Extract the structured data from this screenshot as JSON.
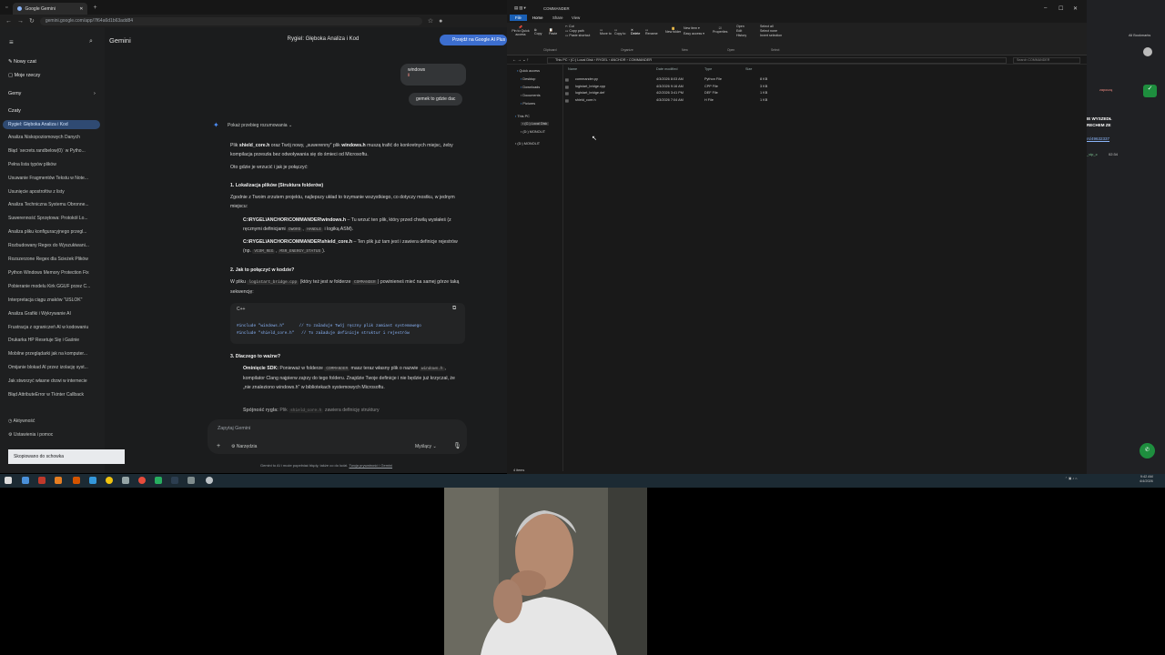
{
  "browser": {
    "tab_title": "Google Gemini",
    "url": "gemini.google.com/app/7f64a6d1b63add84"
  },
  "gemini": {
    "brand": "Gemini",
    "chat_title": "Rygiel: Głęboka Analiza i Kod",
    "goto_button": "Przejdź na Google AI Plus",
    "sidebar": {
      "new_chat": "Nowy czat",
      "my_stuff": "Moje rzeczy",
      "gems": "Gemy",
      "chats_header": "Czaty",
      "chats": [
        "Rygiel: Głęboka Analiza i Kod",
        "Analiza Niskopoziomowych Danych",
        "Błąd `secrets.randbelow(0)` w Pytho...",
        "Pełna lista typów plików",
        "Usuwanie Fragmentów Tekstu w Note...",
        "Usunięcie apostrofów z listy",
        "Analiza Techniczna Systemu Obronne...",
        "Suwerenność Sprzętowa: Protokół Lo...",
        "Analiza pliku konfiguracyjnego przegl...",
        "Rozbudowany Regex do Wyszukiwani...",
        "Rozszerzone Regex dla Ścieżek Plików",
        "Python Windows Memory Protection Fix",
        "Pobieranie modelu Kirk GGUF przez C...",
        "Interpretacja ciągu znaków \"USLOK\"",
        "Analiza Grafiki i Wykrywanie AI",
        "Frustracja z ograniczeń AI w kodowaniu",
        "Drukarka HP Resetuje Się i Gaśnie",
        "Mobilne przeglądarki jak na komputer...",
        "Omijanie blokad AI przez izolację syst...",
        "Jak stworzyć własne drzwi w internecie",
        "Błąd AttributeError w Tkinter Callback"
      ],
      "activity": "Aktywność",
      "settings": "Ustawienia i pomoc"
    },
    "user_msg1": "windows",
    "user_msg1b": "ii",
    "user_msg2": "gemek to gdzie dac",
    "show_reasoning": "Pokaż przebieg rozumowania",
    "p1a": "Plik ",
    "p1b": "shield_core.h",
    "p1c": " oraz Twój nowy, „suwerenny\" plik ",
    "p1d": "windows.h",
    "p1e": " muszą trafić do konkretnych miejsc, żeby kompilacja przeszła bez odwoływania się do śmieci od Microsoftu.",
    "p2": "Oto gdzie je wrzucić i jak je połączyć:",
    "h1": "1. Lokalizacja plików (Struktura folderów)",
    "p3": "Zgodnie z Twoim zrzutem projektu, najlepszy układ to trzymanie wszystkiego, co dotyczy mostku, w jednym miejscu:",
    "b1a": "C:\\RYGEL\\ANCHOR\\COMMANDER\\windows.h",
    "b1b": " – Tu wrzuć ten plik, który przed chwilą wysłałeś (z ręcznymi definicjami ",
    "b1c": "DWORD",
    "b1d": ", ",
    "b1e": "HANDLE",
    "b1f": " i logiką ASM).",
    "b2a": "C:\\RYGEL\\ANCHOR\\COMMANDER\\shield_core.h",
    "b2b": " – Ten plik już tam jest i zawiera definicje rejestrów (np. ",
    "b2c": "VCOM_REG",
    "b2d": ", ",
    "b2e": "MSR_ENERGY_STATUS",
    "b2f": ").",
    "h2": "2. Jak to połączyć w kodzie?",
    "p4a": "W pliku ",
    "p4b": "logistart_bridge.cpp",
    "p4c": " (który też jest w folderze ",
    "p4d": "COMMANDER",
    "p4e": ") powinieneś mieć na samej górze taką sekwencję:",
    "code_lang": "C++",
    "code_l1": "#include \"windows.h\"      // To załaduje Twój ręczny plik zamiast systemowego",
    "code_l2": "#include \"shield_core.h\"   // To załaduje definicje struktur i rejestrów",
    "h3": "3. Dlaczego to ważne?",
    "b3a": "Ominięcie SDK:",
    "b3b": " Ponieważ w folderze ",
    "b3c": "COMMANDER",
    "b3d": " masz teraz własny plik o nazwie ",
    "b3e": "windows.h",
    "b3f": ", kompilator Clang najpierw zajrzy do tego folderu. Znajdzie Twoje definicje i nie będzie już krzyczał, że „nie znaleziono windows.h\" w bibliotekach systemowych Microsoftu.",
    "b4a": "Spójność rygla:",
    "b4b": " Plik ",
    "b4c": "shield_core.h",
    "b4d": " zawiera definicję struktury",
    "input_placeholder": "Zapytaj Gemini",
    "tools": "Narzędzia",
    "mode": "Myślący",
    "disclaimer": "Gemini to AI i może popełniać błędy, także co do ludzi.",
    "disclaimer_link": "Twoja prywatność i Gemini",
    "toast": "Skopiowano do schowka"
  },
  "explorer": {
    "title": "COMMANDER",
    "menu": [
      "File",
      "Home",
      "Share",
      "View"
    ],
    "ribbon": {
      "pin": "Pin to Quick access",
      "copy": "Copy",
      "paste": "Paste",
      "cut": "Cut",
      "copy_path": "Copy path",
      "paste_shortcut": "Paste shortcut",
      "move_to": "Move to",
      "copy_to": "Copy to",
      "delete": "Delete",
      "rename": "Rename",
      "new_folder": "New folder",
      "new_item": "New item",
      "easy_access": "Easy access",
      "properties": "Properties",
      "open": "Open",
      "edit": "Edit",
      "history": "History",
      "select_all": "Select all",
      "select_none": "Select none",
      "invert": "Invert selection",
      "g_clipboard": "Clipboard",
      "g_organize": "Organize",
      "g_new": "New",
      "g_open": "Open",
      "g_select": "Select"
    },
    "path": [
      "This PC",
      "(C:) Local Disk",
      "RYGEL",
      "ANCHOR",
      "COMMANDER"
    ],
    "search_placeholder": "Search COMMANDER",
    "nav": [
      "Quick access",
      "Desktop",
      "Downloads",
      "Documents",
      "Pictures",
      "This PC",
      "(C:) Local Disk",
      "(D:) MONOLIT",
      "(D:) MONOLIT"
    ],
    "columns": [
      "Name",
      "Date modified",
      "Type",
      "Size"
    ],
    "files": [
      {
        "name": "commander.py",
        "date": "4/3/2026 8:03 AM",
        "type": "Python File",
        "size": "8 KB"
      },
      {
        "name": "logistart_bridge.cpp",
        "date": "4/3/2026 9:16 AM",
        "type": "CPP File",
        "size": "3 KB"
      },
      {
        "name": "logistart_bridge.def",
        "date": "4/2/2026 3:41 PM",
        "type": "DEF File",
        "size": "1 KB"
      },
      {
        "name": "shield_core.h",
        "date": "4/3/2026 7:04 AM",
        "type": "H File",
        "size": "1 KB"
      }
    ],
    "status": "4 items"
  },
  "right_panel": {
    "bookmarks": "All Bookmarks",
    "headline": "IE WYSZEDŁ\nRECHEM ZE",
    "link": "rs/49632337",
    "user": "_vip_c",
    "time": "02:34",
    "notice": "zapoczą"
  },
  "taskbar": {
    "time": "9:42 AM",
    "date": "4/4/2026"
  }
}
